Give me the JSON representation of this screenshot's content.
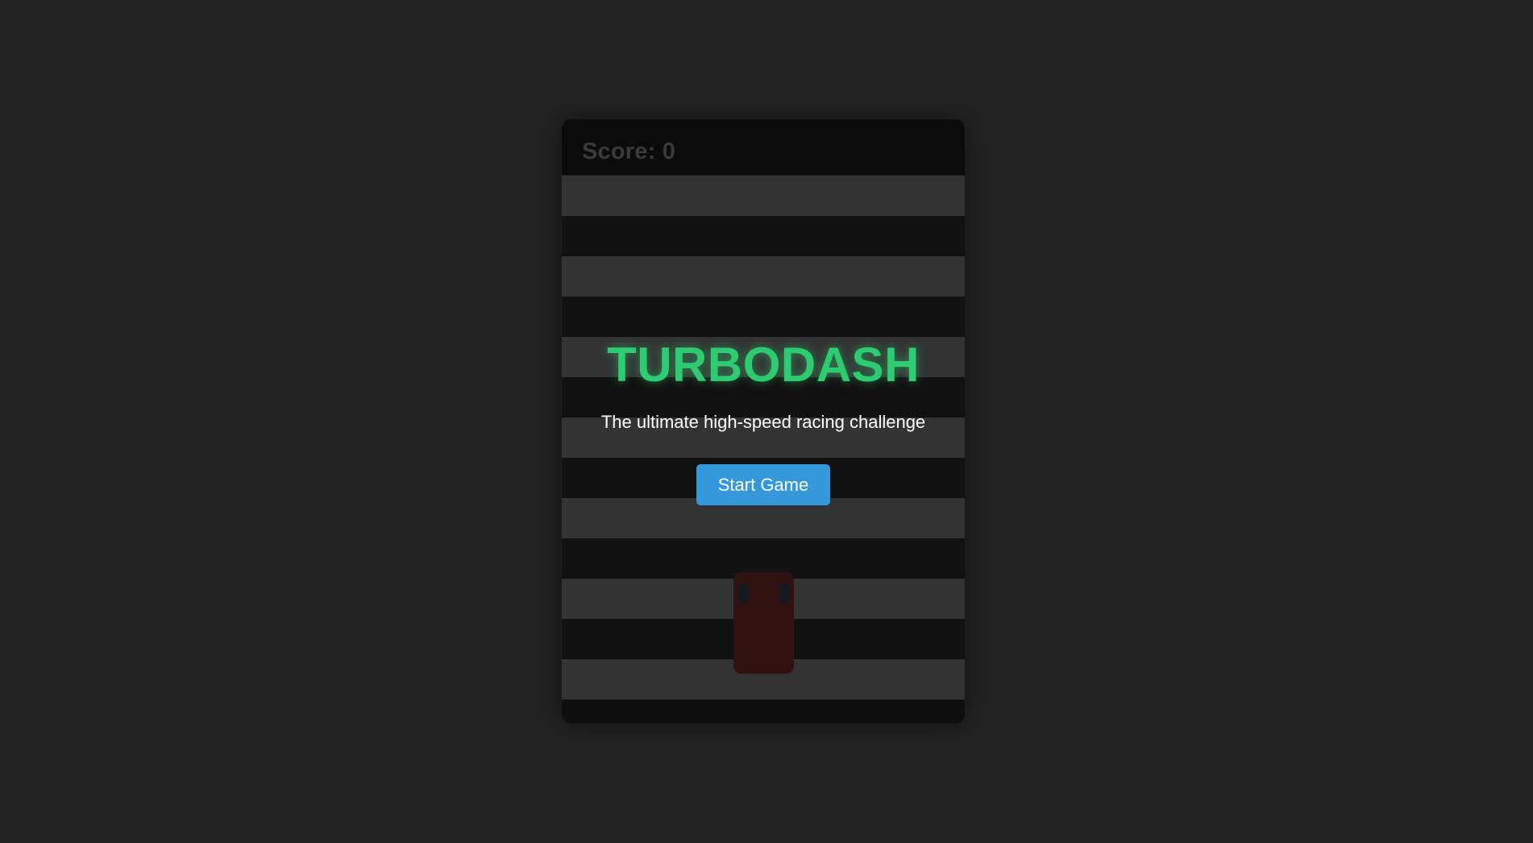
{
  "score": {
    "label": "Score: 0",
    "value": 0
  },
  "start_screen": {
    "title": "TURBODASH",
    "subtitle": "The ultimate high-speed racing challenge",
    "start_button_label": "Start Game"
  },
  "colors": {
    "page_background": "#222222",
    "title_accent": "#2ecc71",
    "button": "#3498db",
    "stripe_light": "#333333",
    "stripe_dark": "#111111",
    "player_car": "#2f110f"
  }
}
